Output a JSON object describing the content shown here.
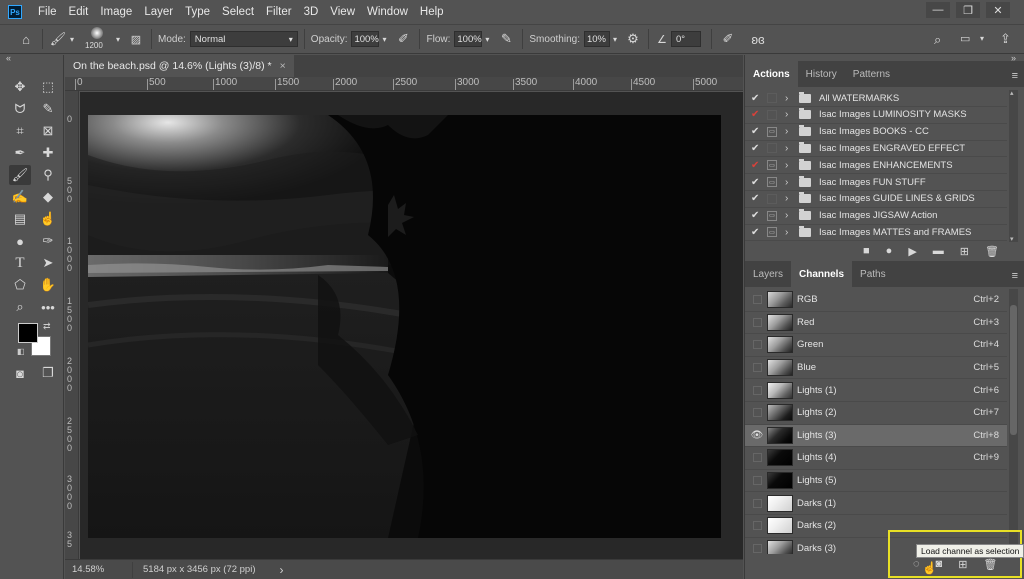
{
  "app": {
    "logo_text": "Ps",
    "menu": [
      "File",
      "Edit",
      "Image",
      "Layer",
      "Type",
      "Select",
      "Filter",
      "3D",
      "View",
      "Window",
      "Help"
    ],
    "window_controls": [
      "minimize",
      "restore",
      "close"
    ]
  },
  "options_bar": {
    "brush_size": "1200",
    "mode_label": "Mode:",
    "mode_value": "Normal",
    "opacity_label": "Opacity:",
    "opacity_value": "100%",
    "flow_label": "Flow:",
    "flow_value": "100%",
    "smoothing_label": "Smoothing:",
    "smoothing_value": "10%",
    "angle_value": "0°"
  },
  "document": {
    "tab_title": "On the beach.psd @ 14.6% (Lights (3)/8) *",
    "tab_close": "×",
    "ruler_top": [
      "0",
      "500",
      "1000",
      "1500",
      "2000",
      "2500",
      "3000",
      "3500",
      "4000",
      "4500",
      "5000"
    ],
    "ruler_left": [
      "0",
      "5\n0\n0",
      "1\n0\n0\n0",
      "1\n5\n0\n0",
      "2\n0\n0\n0",
      "2\n5\n0\n0",
      "3\n0\n0\n0",
      "3\n5"
    ],
    "zoom": "14.58%",
    "doc_info": "5184 px x 3456 px (72 ppi)",
    "status_arrow": "›"
  },
  "actions_panel": {
    "tabs": [
      "Actions",
      "History",
      "Patterns"
    ],
    "active_tab": "Actions",
    "rows": [
      {
        "label": "All WATERMARKS",
        "check": "✔",
        "check_color": "normal",
        "dialog": "empty"
      },
      {
        "label": "Isac Images LUMINOSITY MASKS",
        "check": "✔",
        "check_color": "red",
        "dialog": "empty"
      },
      {
        "label": "Isac Images BOOKS - CC",
        "check": "✔",
        "check_color": "normal",
        "dialog": "on"
      },
      {
        "label": "Isac Images ENGRAVED EFFECT",
        "check": "✔",
        "check_color": "normal",
        "dialog": "empty"
      },
      {
        "label": "Isac Images ENHANCEMENTS",
        "check": "✔",
        "check_color": "red",
        "dialog": "on"
      },
      {
        "label": "Isac Images FUN STUFF",
        "check": "✔",
        "check_color": "normal",
        "dialog": "on"
      },
      {
        "label": "Isac Images GUIDE LINES & GRIDS",
        "check": "✔",
        "check_color": "normal",
        "dialog": "empty"
      },
      {
        "label": "Isac Images JIGSAW Action",
        "check": "✔",
        "check_color": "normal",
        "dialog": "on"
      },
      {
        "label": "Isac Images MATTES and FRAMES",
        "check": "✔",
        "check_color": "normal",
        "dialog": "on"
      }
    ]
  },
  "channels_panel": {
    "tabs": [
      "Layers",
      "Channels",
      "Paths"
    ],
    "active_tab": "Channels",
    "rows": [
      {
        "name": "RGB",
        "shortcut": "Ctrl+2",
        "visible": false,
        "thumb": "color"
      },
      {
        "name": "Red",
        "shortcut": "Ctrl+3",
        "visible": false,
        "thumb": "gray"
      },
      {
        "name": "Green",
        "shortcut": "Ctrl+4",
        "visible": false,
        "thumb": "gray"
      },
      {
        "name": "Blue",
        "shortcut": "Ctrl+5",
        "visible": false,
        "thumb": "gray"
      },
      {
        "name": "Lights (1)",
        "shortcut": "Ctrl+6",
        "visible": false,
        "thumb": "light"
      },
      {
        "name": "Lights (2)",
        "shortcut": "Ctrl+7",
        "visible": false,
        "thumb": "mid"
      },
      {
        "name": "Lights (3)",
        "shortcut": "Ctrl+8",
        "visible": true,
        "selected": true,
        "thumb": "dark"
      },
      {
        "name": "Lights (4)",
        "shortcut": "Ctrl+9",
        "visible": false,
        "thumb": "black"
      },
      {
        "name": "Lights (5)",
        "shortcut": "",
        "visible": false,
        "thumb": "black"
      },
      {
        "name": "Darks (1)",
        "shortcut": "",
        "visible": false,
        "thumb": "white"
      },
      {
        "name": "Darks (2)",
        "shortcut": "",
        "visible": false,
        "thumb": "white"
      },
      {
        "name": "Darks (3)",
        "shortcut": "",
        "visible": false,
        "thumb": "gray"
      }
    ]
  },
  "tooltip": "Load channel as selection",
  "colors": {
    "highlight_box": "#e8e025",
    "panel_bg": "#535353",
    "selected_row": "#6a6a6a",
    "record_red": "#d8413a"
  }
}
